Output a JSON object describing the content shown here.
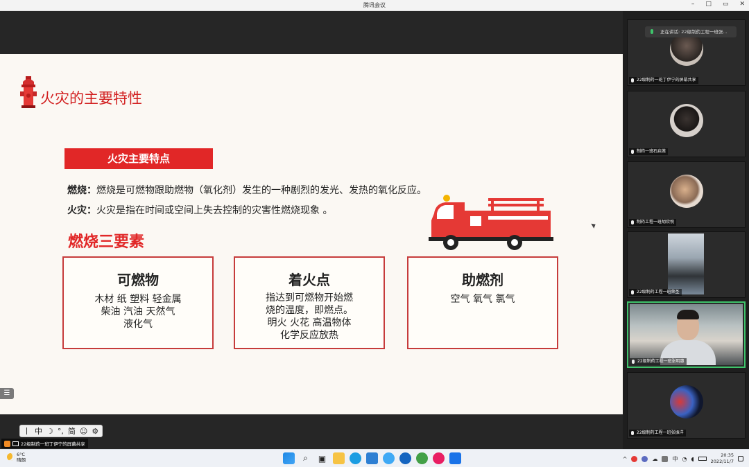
{
  "window": {
    "title": "腾讯会议",
    "controls": [
      "–",
      "□",
      "▭",
      "✕"
    ]
  },
  "slide": {
    "title": "火灾的主要特性",
    "section_bar": "火灾主要特点",
    "combustion_label": "燃烧：",
    "combustion_text": "燃烧是可燃物跟助燃物（氧化剂）发生的一种剧烈的发光、发热的氧化反应。",
    "fire_label": "火灾：",
    "fire_text": "火灾是指在时间或空间上失去控制的灾害性燃烧现象 。",
    "three_elements_title": "燃烧三要素",
    "boxes": [
      {
        "head": "可燃物",
        "lines": [
          "木材 纸 塑料 轻金属",
          "柴油  汽油   天然气",
          "液化气"
        ]
      },
      {
        "head": "着火点",
        "lines": [
          "指达到可燃物开始燃",
          "烧的温度，即燃点。",
          "明火  火花  高温物体",
          "化学反应放热"
        ]
      },
      {
        "head": "助燃剂",
        "lines": [
          "空气  氧气  氯气"
        ]
      }
    ]
  },
  "ime": {
    "items": [
      "丨",
      "中",
      "☽",
      "°,",
      "简",
      "☺",
      "⚙"
    ]
  },
  "share_label": "22级制药一班丁伊宁的屏幕共享",
  "speaking": "正在讲话: 22级制药工程一班张...",
  "participants": [
    {
      "name": "22级制药一班丁伊宁的屏幕共享"
    },
    {
      "name": "制药一班石启莲"
    },
    {
      "name": "制药工程一班胡欣悦"
    },
    {
      "name": "22级制药工程一班荣圣"
    },
    {
      "name": "22级制药工程一班张明惠"
    },
    {
      "name": "22级制药工程一班张振洋"
    }
  ],
  "taskbar": {
    "weather_temp": "6°C",
    "weather_desc": "晴朗",
    "lang": "中",
    "time": "20:35",
    "date": "2022/11/7"
  },
  "colors": {
    "accent_red": "#e12727",
    "box_border": "#c63b3b",
    "speaker_green": "#3fc36b"
  }
}
